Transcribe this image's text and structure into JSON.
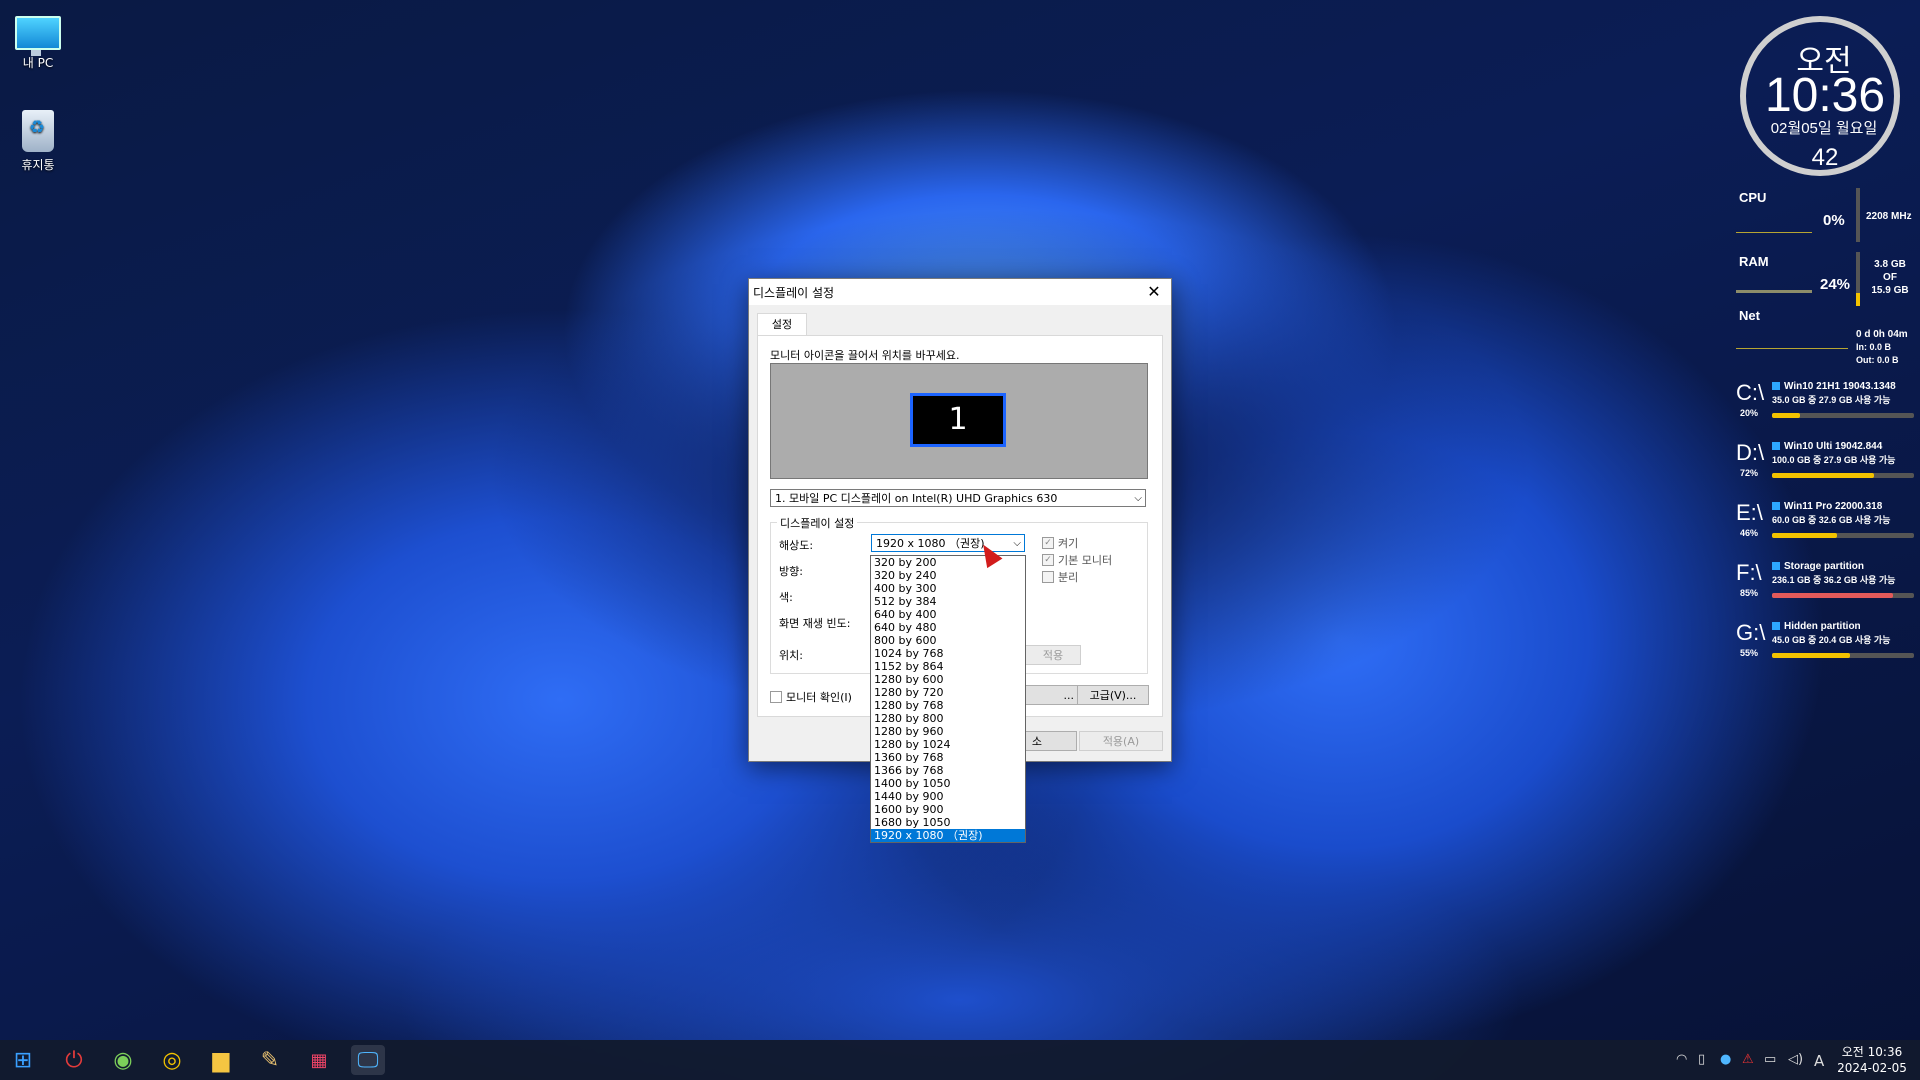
{
  "desktop": {
    "icons": [
      {
        "label": "내 PC",
        "icon": "this-pc-icon"
      },
      {
        "label": "휴지통",
        "icon": "recycle-bin-icon"
      }
    ]
  },
  "gadget": {
    "ampm": "오전",
    "time": "10:36",
    "date": "02월05일 월요일",
    "seconds": "42",
    "cpu": {
      "label": "CPU",
      "percent": "0%",
      "freq": "2208 MHz"
    },
    "ram": {
      "label": "RAM",
      "percent": "24%",
      "used": "3.8 GB",
      "of": "OF",
      "total": "15.9 GB"
    },
    "net": {
      "label": "Net",
      "uptime": "0 d 0h 04m",
      "in": "In: 0.0 B",
      "out": "Out: 0.0 B"
    },
    "drives": [
      {
        "letter": "C:\\",
        "name": "Win10 21H1 19043.1348",
        "detail": "35.0 GB 중   27.9 GB 사용 가능",
        "percent": "20%",
        "fill": 0.2,
        "color": "#f2c200"
      },
      {
        "letter": "D:\\",
        "name": "Win10 Ulti 19042.844",
        "detail": "100.0 GB 중 27.9 GB 사용 가능",
        "percent": "72%",
        "fill": 0.72,
        "color": "#f2c200"
      },
      {
        "letter": "E:\\",
        "name": "Win11 Pro 22000.318",
        "detail": "60.0 GB 중   32.6 GB 사용 가능",
        "percent": "46%",
        "fill": 0.46,
        "color": "#f2c200"
      },
      {
        "letter": "F:\\",
        "name": "Storage partition",
        "detail": "236.1 GB 중 36.2 GB 사용 가능",
        "percent": "85%",
        "fill": 0.85,
        "color": "#e35a5a"
      },
      {
        "letter": "G:\\",
        "name": "Hidden partition",
        "detail": "45.0 GB 중    20.4 GB 사용 가능",
        "percent": "55%",
        "fill": 0.55,
        "color": "#f2c200"
      }
    ]
  },
  "dialog": {
    "title": "디스플레이 설정",
    "tab": "설정",
    "hint": "모니터 아이콘을 끌어서 위치를 바꾸세요.",
    "monitor_number": "1",
    "display_select": "1. 모바일 PC 디스플레이 on Intel(R) UHD Graphics 630",
    "group_title": "디스플레이 설정",
    "labels": {
      "resolution": "해상도:",
      "orientation": "방향:",
      "color": "색:",
      "refresh": "화면 재생 빈도:",
      "position": "위치:"
    },
    "resolution_value": "1920 x 1080 （권장)",
    "checks": {
      "on": "켜기",
      "primary": "기본 모니터",
      "detach": "분리"
    },
    "monitor_check": "모니터 확인(I)",
    "buttons": {
      "apply_small": "적용",
      "identify_partial": "...",
      "advanced": "고급(V)...",
      "cancel_partial": "소",
      "apply": "적용(A)"
    },
    "resolution_options": [
      "320 by 200",
      "320 by 240",
      "400 by 300",
      "512 by 384",
      "640 by 400",
      "640 by 480",
      "800 by 600",
      "1024 by 768",
      "1152 by 864",
      "1280 by 600",
      "1280 by 720",
      "1280 by 768",
      "1280 by 800",
      "1280 by 960",
      "1280 by 1024",
      "1360 by 768",
      "1366 by 768",
      "1400 by 1050",
      "1440 by 900",
      "1600 by 900",
      "1680 by 1050",
      "1920 x 1080 （권장)"
    ]
  },
  "taskbar": {
    "apps": [
      "start-icon",
      "power-icon",
      "photos-icon",
      "chrome-icon",
      "file-explorer-icon",
      "tool-icon",
      "apps-grid-icon",
      "display-settings-icon"
    ],
    "tray_time": "오전 10:36",
    "tray_date": "2024-02-05",
    "ime": "A"
  }
}
